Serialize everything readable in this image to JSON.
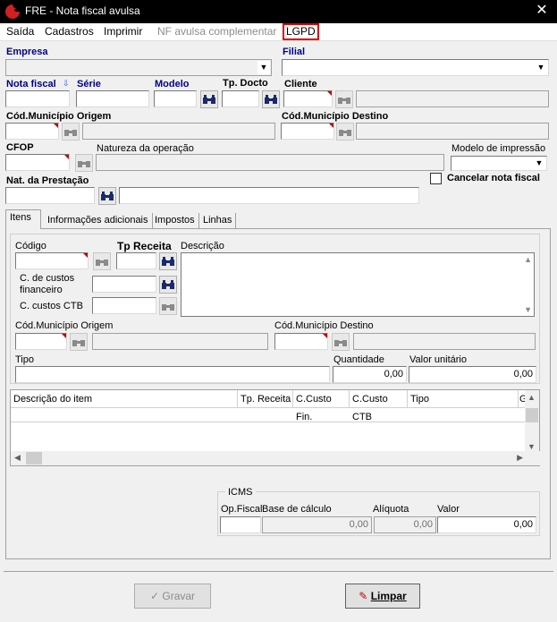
{
  "window": {
    "title": "FRE - Nota fiscal avulsa",
    "close": "✕"
  },
  "menu": [
    "Saída",
    "Cadastros",
    "Imprimir",
    "NF avulsa complementar",
    "LGPD"
  ],
  "labels": {
    "empresa": "Empresa",
    "filial": "Filial",
    "nota_fiscal": "Nota fiscal",
    "serie": "Série",
    "modelo": "Modelo",
    "tp_docto": "Tp. Docto",
    "cliente": "Cliente",
    "mun_origem": "Cód.Município Origem",
    "mun_destino": "Cód.Município Destino",
    "cfop": "CFOP",
    "natureza": "Natureza da operação",
    "modelo_impressao": "Modelo de impressão",
    "nat_prestacao": "Nat. da Prestação",
    "cancelar": "Cancelar nota fiscal"
  },
  "tabs": [
    "Itens",
    "Informações adicionais",
    "Impostos",
    "Linhas"
  ],
  "itens": {
    "codigo": "Código",
    "tp_receita": "Tp Receita",
    "descricao": "Descrição",
    "cc_fin": "C. de custos\nfinanceiro",
    "cc_ctb": "C. custos CTB",
    "mun_origem": "Cód.Município Origem",
    "mun_destino": "Cód.Município Destino",
    "tipo": "Tipo",
    "quantidade": "Quantidade",
    "valor_unitario": "Valor unitário",
    "quantidade_val": "0,00",
    "valor_unitario_val": "0,00"
  },
  "grid": {
    "columns": [
      "Descrição do item",
      "Tp. Receita",
      "C.Custo Fin.",
      "C.Custo CTB",
      "Tipo",
      "G"
    ]
  },
  "icms": {
    "legend": "ICMS",
    "op_fiscal": "Op.Fiscal",
    "base": "Base de cálculo",
    "aliquota": "Alíquota",
    "valor": "Valor",
    "base_val": "0,00",
    "aliquota_val": "0,00",
    "valor_val": "0,00"
  },
  "buttons": {
    "gravar": "Gravar",
    "limpar": "Limpar"
  }
}
